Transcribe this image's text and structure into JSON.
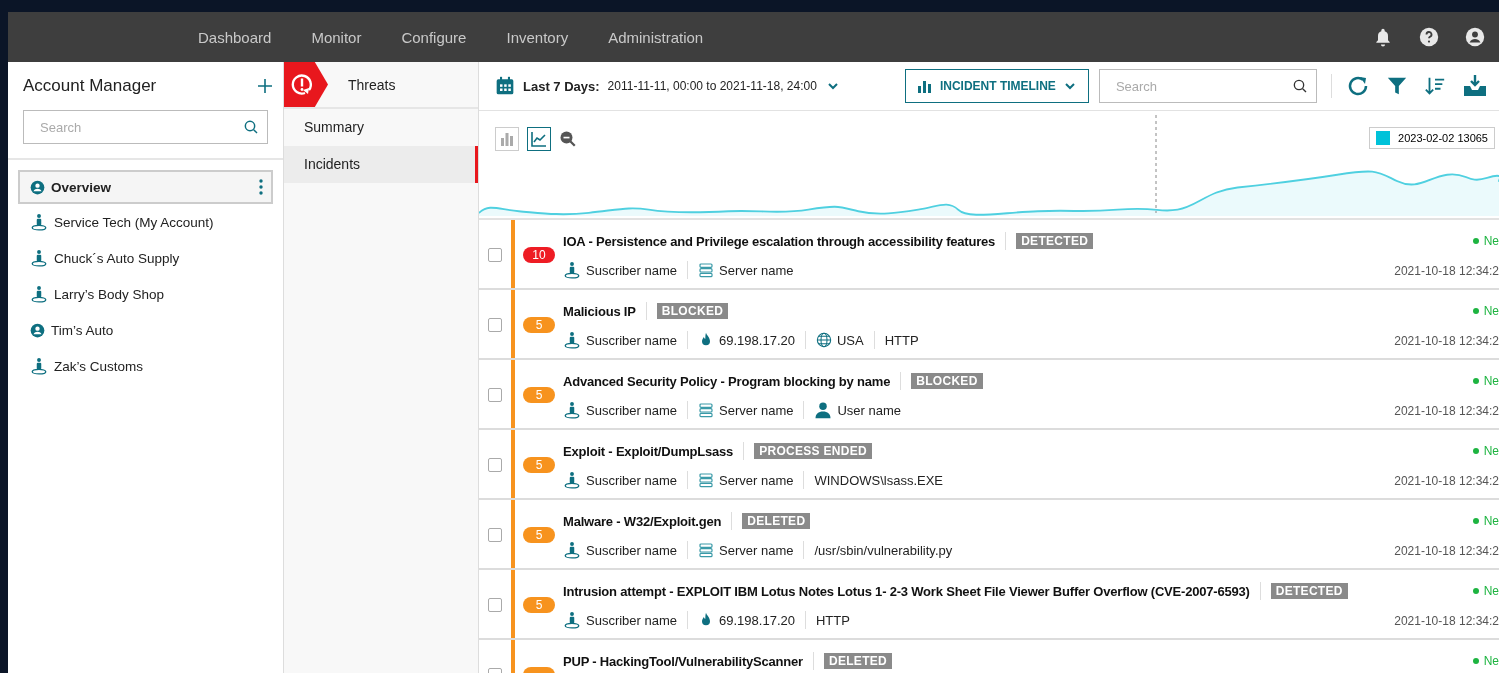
{
  "top_nav": {
    "items": [
      {
        "label": "Dashboard",
        "selected": false
      },
      {
        "label": "Monitor",
        "selected": false
      },
      {
        "label": "Configure",
        "selected": false
      },
      {
        "label": "Inventory",
        "selected": false
      },
      {
        "label": "Administration",
        "selected": false
      }
    ]
  },
  "account_manager": {
    "title": "Account Manager",
    "search": {
      "placeholder": "Search"
    },
    "accounts": [
      {
        "name": "Overview",
        "kind": "group",
        "selected": true
      },
      {
        "name": "Service Tech (My Account)",
        "kind": "customer",
        "selected": false
      },
      {
        "name": "Chuck´s Auto Supply",
        "kind": "customer",
        "selected": false
      },
      {
        "name": "Larry’s Body Shop",
        "kind": "customer",
        "selected": false
      },
      {
        "name": "Tim’s Auto",
        "kind": "group",
        "selected": false
      },
      {
        "name": "Zak’s Customs",
        "kind": "customer",
        "selected": false
      }
    ]
  },
  "section_nav": {
    "title": "Threats",
    "items": [
      {
        "label": "Summary",
        "selected": false
      },
      {
        "label": "Incidents",
        "selected": true
      }
    ]
  },
  "toolbar": {
    "range_label": "Last 7 Days:",
    "range_value": "2011-11-11, 00:00 to 2021-11-18, 24:00",
    "view_button": "INCIDENT TIMELINE",
    "search": {
      "placeholder": "Search"
    }
  },
  "timeline": {
    "legend": {
      "label": "2023-02-02 13065",
      "color": "#00c2d9"
    },
    "bar_view_selected": false,
    "line_view_selected": true
  },
  "incidents": [
    {
      "severity": "10",
      "color": "#ee1c24",
      "title": "IOA - Persistence and Privilege escalation through accessibility features",
      "tag": "DETECTED",
      "checked": false,
      "meta": [
        {
          "kind": "subscriber",
          "text": "Suscriber name"
        },
        {
          "kind": "server",
          "text": "Server name"
        }
      ],
      "status": "Ne",
      "time": "2021-10-18 12:34:2"
    },
    {
      "severity": "5",
      "color": "#f7931e",
      "title": "Malicious IP",
      "tag": "BLOCKED",
      "checked": false,
      "meta": [
        {
          "kind": "subscriber",
          "text": "Suscriber name"
        },
        {
          "kind": "ip",
          "text": "69.198.17.20"
        },
        {
          "kind": "country",
          "text": "USA"
        },
        {
          "kind": "plain",
          "text": "HTTP"
        }
      ],
      "status": "Ne",
      "time": "2021-10-18 12:34:2"
    },
    {
      "severity": "5",
      "color": "#f7931e",
      "title": "Advanced Security Policy - Program blocking by name",
      "tag": "BLOCKED",
      "checked": false,
      "meta": [
        {
          "kind": "subscriber",
          "text": "Suscriber name"
        },
        {
          "kind": "server",
          "text": "Server name"
        },
        {
          "kind": "user",
          "text": "User name"
        }
      ],
      "status": "Ne",
      "time": "2021-10-18 12:34:2"
    },
    {
      "severity": "5",
      "color": "#f7931e",
      "title": "Exploit - Exploit/DumpLsass",
      "tag": "PROCESS ENDED",
      "checked": false,
      "meta": [
        {
          "kind": "subscriber",
          "text": "Suscriber name"
        },
        {
          "kind": "server",
          "text": "Server name"
        },
        {
          "kind": "plain",
          "text": "WINDOWS\\lsass.EXE"
        }
      ],
      "status": "Ne",
      "time": "2021-10-18 12:34:2"
    },
    {
      "severity": "5",
      "color": "#f7931e",
      "title": "Malware - W32/Exploit.gen",
      "tag": "DELETED",
      "checked": false,
      "meta": [
        {
          "kind": "subscriber",
          "text": "Suscriber name"
        },
        {
          "kind": "server",
          "text": "Server name"
        },
        {
          "kind": "plain",
          "text": "/usr/sbin/vulnerability.py"
        }
      ],
      "status": "Ne",
      "time": "2021-10-18 12:34:2"
    },
    {
      "severity": "5",
      "color": "#f7931e",
      "title": "Intrusion attempt - EXPLOIT IBM Lotus Notes Lotus 1- 2-3 Work Sheet File Viewer Buffer Overflow (CVE-2007-6593)",
      "tag": "DETECTED",
      "checked": false,
      "meta": [
        {
          "kind": "subscriber",
          "text": "Suscriber name"
        },
        {
          "kind": "ip",
          "text": "69.198.17.20"
        },
        {
          "kind": "plain",
          "text": "HTTP"
        }
      ],
      "status": "Ne",
      "time": "2021-10-18 12:34:2"
    },
    {
      "color": "#f7931e",
      "title": "PUP - HackingTool/VulnerabilityScanner",
      "tag": "DELETED",
      "checked": false,
      "status": "Ne"
    }
  ]
}
